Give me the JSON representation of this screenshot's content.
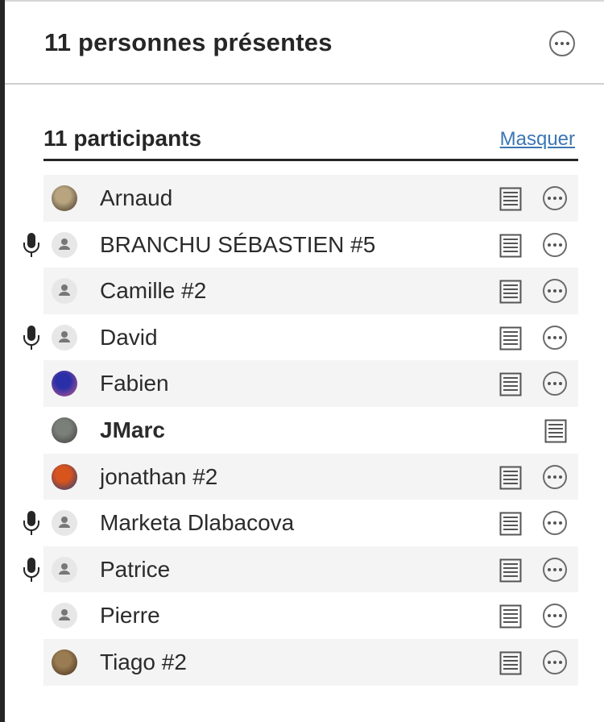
{
  "header": {
    "title": "11 personnes présentes",
    "more_icon": "more-icon"
  },
  "section": {
    "title": "11 participants",
    "hide_label": "Masquer"
  },
  "participants": [
    {
      "name": "Arnaud",
      "avatar": "photo",
      "avatar_colors": [
        "#b8a57f",
        "#3a2e22"
      ],
      "mic": false,
      "bold": false,
      "more": true
    },
    {
      "name": "BRANCHU SÉBASTIEN #5",
      "avatar": "generic",
      "mic": true,
      "bold": false,
      "more": true
    },
    {
      "name": "Camille #2",
      "avatar": "generic",
      "mic": false,
      "bold": false,
      "more": true
    },
    {
      "name": "David",
      "avatar": "generic",
      "mic": true,
      "bold": false,
      "more": true
    },
    {
      "name": "Fabien",
      "avatar": "photo",
      "avatar_colors": [
        "#2a2fa8",
        "#c45a8a"
      ],
      "mic": false,
      "bold": false,
      "more": true
    },
    {
      "name": "JMarc",
      "avatar": "photo",
      "avatar_colors": [
        "#7b7f7a",
        "#3c3d39"
      ],
      "mic": false,
      "bold": true,
      "more": false
    },
    {
      "name": "jonathan #2",
      "avatar": "photo",
      "avatar_colors": [
        "#d8541d",
        "#1d3c84"
      ],
      "mic": false,
      "bold": false,
      "more": true
    },
    {
      "name": "Marketa Dlabacova",
      "avatar": "generic",
      "mic": true,
      "bold": false,
      "more": true
    },
    {
      "name": "Patrice",
      "avatar": "generic",
      "mic": true,
      "bold": false,
      "more": true
    },
    {
      "name": "Pierre",
      "avatar": "generic",
      "mic": false,
      "bold": false,
      "more": true
    },
    {
      "name": "Tiago #2",
      "avatar": "photo",
      "avatar_colors": [
        "#9a7c52",
        "#3e2a18"
      ],
      "mic": false,
      "bold": false,
      "more": true
    }
  ],
  "colors": {
    "link": "#3b76b4",
    "row_alt": "#f4f4f4",
    "text": "#262626",
    "icon": "#555555"
  }
}
